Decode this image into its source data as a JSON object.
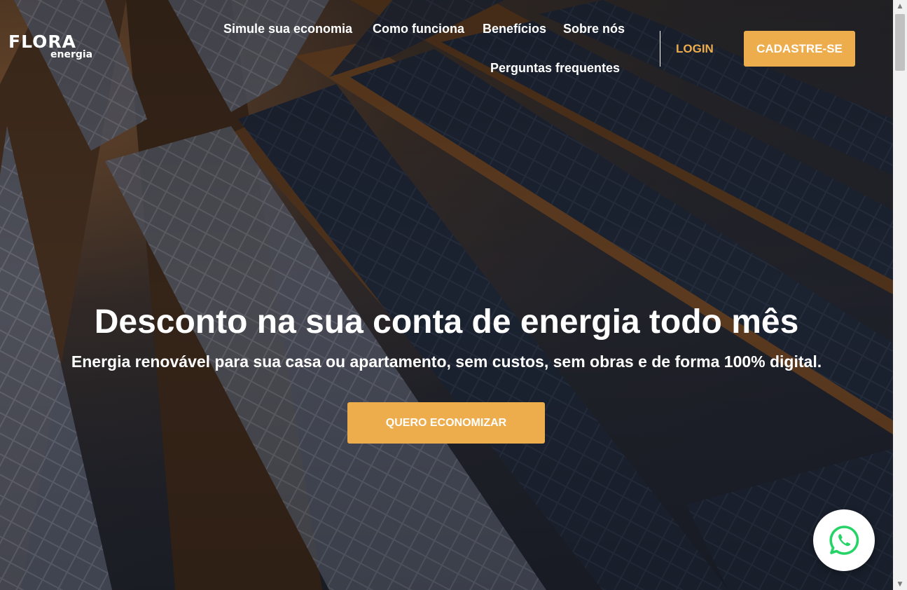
{
  "logo": {
    "word": "FLORA",
    "sub": "energia"
  },
  "nav": {
    "items": [
      {
        "label": "Simule sua economia"
      },
      {
        "label": "Como funciona"
      },
      {
        "label": "Benefícios"
      },
      {
        "label": "Sobre nós"
      },
      {
        "label": "Perguntas frequentes"
      }
    ],
    "login": "LOGIN",
    "signup": "CADASTRE-SE"
  },
  "hero": {
    "headline": "Desconto na sua conta de energia todo mês",
    "subheadline": "Energia renovável para sua casa ou apartamento, sem custos, sem obras e de forma 100% digital.",
    "cta": "QUERO ECONOMIZAR"
  },
  "floating": {
    "icon": "whatsapp-icon"
  },
  "colors": {
    "accent": "#eead4d",
    "whatsapp": "#25d366",
    "text": "#ffffff"
  }
}
